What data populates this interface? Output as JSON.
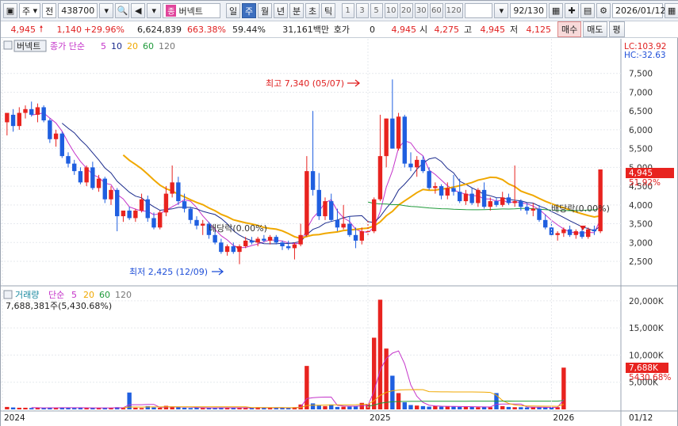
{
  "toolbar": {
    "market_mode": "주",
    "market_scope": "전",
    "code": "438700",
    "stock_name_tag": "종",
    "stock_name": "버넥트",
    "period_tabs": [
      "일",
      "주",
      "월",
      "년",
      "분",
      "초",
      "틱"
    ],
    "active_period": "주",
    "interval_buttons": [
      "1",
      "3",
      "5",
      "10",
      "20",
      "30",
      "60",
      "120"
    ],
    "bar_count": "92/130",
    "date": "2026/01/12"
  },
  "quote": {
    "price": "4,945",
    "change": "1,140",
    "change_pct": "+29.96%",
    "volume": "6,624,839",
    "volume_ratio": "663.38%",
    "turnover": "59.44%",
    "amount": "31,161백만",
    "quote_label": "호가",
    "quote_value": "0",
    "quote_price": "4,945",
    "open_label": "시",
    "open": "4,275",
    "high_label": "고",
    "high": "4,945",
    "low_label": "저",
    "low": "4,125",
    "buy_label": "매수",
    "sell_label": "매도",
    "eval_label": "평"
  },
  "price_panel": {
    "tab_label": "버넥트",
    "legend_prefix": "종가 단순",
    "ma_periods": [
      "5",
      "10",
      "20",
      "60",
      "120"
    ],
    "lc_label": "LC:103.92",
    "hc_label": "HC:-32.63",
    "current_price_tag": "4,945",
    "current_pct_tag": "51.92%",
    "high_annotation": "최고 7,340 (05/07)",
    "low_annotation": "최저 2,425 (12/09)",
    "dividend_annotation_1": "배당락(0.00%)",
    "dividend_annotation_2": "배당락(0.00%)"
  },
  "volume_panel": {
    "title": "거래량",
    "legend_prefix": "단순",
    "ma_periods": [
      "5",
      "20",
      "60",
      "120"
    ],
    "volume_summary": "7,688,381주(5,430.68%)",
    "current_tag": "7,688K",
    "current_pct_tag": "5430.68%"
  },
  "colors": {
    "up": "#e8231f",
    "down": "#1f5fe0",
    "ma5": "#c433c9",
    "ma10": "#1a2a8c",
    "ma20": "#f0a800",
    "ma60": "#1f9a3a",
    "ma120": "#777777"
  },
  "chart_data": {
    "type": "candlestick",
    "x_start_label": "2024",
    "x_tick_labels": [
      "2024",
      "2025",
      "2026"
    ],
    "x_right_label": "01/12",
    "price_axis": {
      "ylim": [
        2100,
        8000
      ],
      "ticks": [
        2500,
        3000,
        3500,
        4000,
        4500,
        5000,
        5500,
        6000,
        6500,
        7000,
        7500
      ]
    },
    "volume_axis": {
      "ylim": [
        0,
        21000
      ],
      "ticks": [
        5000,
        10000,
        15000,
        20000
      ],
      "tick_labels": [
        "5,000K",
        "10,000K",
        "15,000K",
        "20,000K"
      ]
    },
    "candles": [
      {
        "o": 6200,
        "h": 6400,
        "l": 5850,
        "c": 6450
      },
      {
        "o": 6400,
        "h": 6550,
        "l": 5950,
        "c": 6100
      },
      {
        "o": 6100,
        "h": 6600,
        "l": 6000,
        "c": 6450
      },
      {
        "o": 6450,
        "h": 6650,
        "l": 6300,
        "c": 6550
      },
      {
        "o": 6550,
        "h": 6750,
        "l": 6350,
        "c": 6400
      },
      {
        "o": 6400,
        "h": 6700,
        "l": 6200,
        "c": 6600
      },
      {
        "o": 6600,
        "h": 6650,
        "l": 6200,
        "c": 6250
      },
      {
        "o": 6250,
        "h": 6300,
        "l": 5650,
        "c": 5750
      },
      {
        "o": 5750,
        "h": 6000,
        "l": 5550,
        "c": 5900
      },
      {
        "o": 5900,
        "h": 5950,
        "l": 5250,
        "c": 5300
      },
      {
        "o": 5300,
        "h": 5400,
        "l": 5000,
        "c": 5100
      },
      {
        "o": 5100,
        "h": 5200,
        "l": 4800,
        "c": 4900
      },
      {
        "o": 4900,
        "h": 5000,
        "l": 4550,
        "c": 4600
      },
      {
        "o": 4600,
        "h": 5050,
        "l": 4500,
        "c": 5000
      },
      {
        "o": 5000,
        "h": 5150,
        "l": 4400,
        "c": 4450
      },
      {
        "o": 4450,
        "h": 4800,
        "l": 4350,
        "c": 4700
      },
      {
        "o": 4700,
        "h": 4750,
        "l": 4050,
        "c": 4150
      },
      {
        "o": 4150,
        "h": 4500,
        "l": 4000,
        "c": 4400
      },
      {
        "o": 4400,
        "h": 4450,
        "l": 3300,
        "c": 3700
      },
      {
        "o": 3700,
        "h": 3800,
        "l": 3550,
        "c": 3850
      },
      {
        "o": 3850,
        "h": 3950,
        "l": 3600,
        "c": 3650
      },
      {
        "o": 3650,
        "h": 3900,
        "l": 3550,
        "c": 3850
      },
      {
        "o": 3850,
        "h": 4300,
        "l": 3800,
        "c": 4150
      },
      {
        "o": 4150,
        "h": 4250,
        "l": 3550,
        "c": 3650
      },
      {
        "o": 3650,
        "h": 3800,
        "l": 3350,
        "c": 3400
      },
      {
        "o": 3400,
        "h": 3850,
        "l": 3350,
        "c": 3800
      },
      {
        "o": 3800,
        "h": 4500,
        "l": 3700,
        "c": 4300
      },
      {
        "o": 4300,
        "h": 5050,
        "l": 4200,
        "c": 4600
      },
      {
        "o": 4600,
        "h": 4750,
        "l": 4000,
        "c": 4100
      },
      {
        "o": 4100,
        "h": 4300,
        "l": 3800,
        "c": 3900
      },
      {
        "o": 3900,
        "h": 3950,
        "l": 3500,
        "c": 3600
      },
      {
        "o": 3600,
        "h": 3700,
        "l": 3350,
        "c": 3450
      },
      {
        "o": 3450,
        "h": 3600,
        "l": 3200,
        "c": 3500
      },
      {
        "o": 3500,
        "h": 3550,
        "l": 3100,
        "c": 3200
      },
      {
        "o": 3200,
        "h": 3350,
        "l": 2950,
        "c": 3000
      },
      {
        "o": 3000,
        "h": 3100,
        "l": 2700,
        "c": 2750
      },
      {
        "o": 2750,
        "h": 2950,
        "l": 2650,
        "c": 2900
      },
      {
        "o": 2900,
        "h": 3000,
        "l": 2700,
        "c": 2750
      },
      {
        "o": 2750,
        "h": 2950,
        "l": 2425,
        "c": 2900
      },
      {
        "o": 2900,
        "h": 3150,
        "l": 2850,
        "c": 3050
      },
      {
        "o": 3050,
        "h": 3150,
        "l": 2950,
        "c": 3000
      },
      {
        "o": 3000,
        "h": 3150,
        "l": 2900,
        "c": 3100
      },
      {
        "o": 3100,
        "h": 3200,
        "l": 3000,
        "c": 3050
      },
      {
        "o": 3050,
        "h": 3200,
        "l": 2950,
        "c": 3150
      },
      {
        "o": 3150,
        "h": 3200,
        "l": 2950,
        "c": 3000
      },
      {
        "o": 3000,
        "h": 3050,
        "l": 2800,
        "c": 2900
      },
      {
        "o": 2900,
        "h": 3050,
        "l": 2800,
        "c": 2850
      },
      {
        "o": 2850,
        "h": 3000,
        "l": 2550,
        "c": 2950
      },
      {
        "o": 2950,
        "h": 3500,
        "l": 2900,
        "c": 3200
      },
      {
        "o": 3200,
        "h": 5300,
        "l": 3150,
        "c": 4900
      },
      {
        "o": 4900,
        "h": 6500,
        "l": 4250,
        "c": 4400
      },
      {
        "o": 4400,
        "h": 4850,
        "l": 3600,
        "c": 3700
      },
      {
        "o": 3700,
        "h": 4200,
        "l": 3600,
        "c": 4100
      },
      {
        "o": 4100,
        "h": 4300,
        "l": 3550,
        "c": 3600
      },
      {
        "o": 3600,
        "h": 3900,
        "l": 3300,
        "c": 3400
      },
      {
        "o": 3400,
        "h": 4000,
        "l": 3350,
        "c": 3500
      },
      {
        "o": 3500,
        "h": 3700,
        "l": 3150,
        "c": 3200
      },
      {
        "o": 3200,
        "h": 3400,
        "l": 2850,
        "c": 3050
      },
      {
        "o": 3050,
        "h": 3400,
        "l": 2950,
        "c": 3300
      },
      {
        "o": 3300,
        "h": 3600,
        "l": 3200,
        "c": 3300
      },
      {
        "o": 3300,
        "h": 4200,
        "l": 3250,
        "c": 4150
      },
      {
        "o": 4150,
        "h": 6400,
        "l": 4100,
        "c": 5300
      },
      {
        "o": 5300,
        "h": 6300,
        "l": 5000,
        "c": 6300
      },
      {
        "o": 6300,
        "h": 7340,
        "l": 5500,
        "c": 5500
      },
      {
        "o": 5500,
        "h": 6450,
        "l": 5450,
        "c": 6350
      },
      {
        "o": 6350,
        "h": 6400,
        "l": 5000,
        "c": 5100
      },
      {
        "o": 5100,
        "h": 5400,
        "l": 4900,
        "c": 5000
      },
      {
        "o": 5000,
        "h": 5300,
        "l": 4750,
        "c": 5200
      },
      {
        "o": 5200,
        "h": 5300,
        "l": 4850,
        "c": 4900
      },
      {
        "o": 4900,
        "h": 5000,
        "l": 4400,
        "c": 4450
      },
      {
        "o": 4450,
        "h": 4600,
        "l": 4300,
        "c": 4500
      },
      {
        "o": 4500,
        "h": 4550,
        "l": 4150,
        "c": 4250
      },
      {
        "o": 4250,
        "h": 4600,
        "l": 4150,
        "c": 4450
      },
      {
        "o": 4450,
        "h": 4800,
        "l": 4250,
        "c": 4350
      },
      {
        "o": 4350,
        "h": 4700,
        "l": 4050,
        "c": 4100
      },
      {
        "o": 4100,
        "h": 4400,
        "l": 4000,
        "c": 4300
      },
      {
        "o": 4300,
        "h": 4450,
        "l": 4000,
        "c": 4050
      },
      {
        "o": 4050,
        "h": 4450,
        "l": 3950,
        "c": 4400
      },
      {
        "o": 4400,
        "h": 4600,
        "l": 3900,
        "c": 3950
      },
      {
        "o": 3950,
        "h": 4200,
        "l": 3850,
        "c": 4100
      },
      {
        "o": 4100,
        "h": 4200,
        "l": 3950,
        "c": 4000
      },
      {
        "o": 4000,
        "h": 4350,
        "l": 3950,
        "c": 4200
      },
      {
        "o": 4200,
        "h": 4300,
        "l": 4000,
        "c": 4050
      },
      {
        "o": 4050,
        "h": 5050,
        "l": 3950,
        "c": 4100
      },
      {
        "o": 4100,
        "h": 4150,
        "l": 3850,
        "c": 3950
      },
      {
        "o": 3950,
        "h": 4050,
        "l": 3750,
        "c": 3850
      },
      {
        "o": 3850,
        "h": 4050,
        "l": 3700,
        "c": 3900
      },
      {
        "o": 3900,
        "h": 4000,
        "l": 3550,
        "c": 3600
      },
      {
        "o": 3600,
        "h": 3750,
        "l": 3350,
        "c": 3400
      },
      {
        "o": 3400,
        "h": 3550,
        "l": 3150,
        "c": 3200
      },
      {
        "o": 3200,
        "h": 3300,
        "l": 3050,
        "c": 3250
      },
      {
        "o": 3250,
        "h": 3400,
        "l": 3150,
        "c": 3350
      },
      {
        "o": 3350,
        "h": 3450,
        "l": 3150,
        "c": 3200
      },
      {
        "o": 3200,
        "h": 3350,
        "l": 3100,
        "c": 3300
      },
      {
        "o": 3300,
        "h": 3400,
        "l": 3100,
        "c": 3150
      },
      {
        "o": 3150,
        "h": 3400,
        "l": 3100,
        "c": 3350
      },
      {
        "o": 3350,
        "h": 3450,
        "l": 3200,
        "c": 3300
      },
      {
        "o": 3300,
        "h": 4945,
        "l": 3250,
        "c": 4945
      }
    ],
    "volumes_k": [
      450,
      350,
      300,
      300,
      250,
      300,
      250,
      350,
      300,
      350,
      300,
      250,
      300,
      250,
      300,
      250,
      300,
      250,
      400,
      250,
      3100,
      300,
      250,
      600,
      350,
      300,
      650,
      500,
      400,
      300,
      250,
      300,
      250,
      300,
      250,
      350,
      300,
      250,
      300,
      250,
      300,
      400,
      250,
      300,
      250,
      300,
      300,
      400,
      900,
      8000,
      1100,
      700,
      600,
      900,
      450,
      500,
      500,
      600,
      1200,
      1000,
      13200,
      20200,
      11200,
      6200,
      3000,
      1300,
      800,
      700,
      600,
      500,
      600,
      500,
      600,
      500,
      450,
      500,
      450,
      400,
      450,
      400,
      3000,
      600,
      450,
      400,
      400,
      350,
      400,
      400,
      350,
      350,
      400,
      7688
    ]
  }
}
